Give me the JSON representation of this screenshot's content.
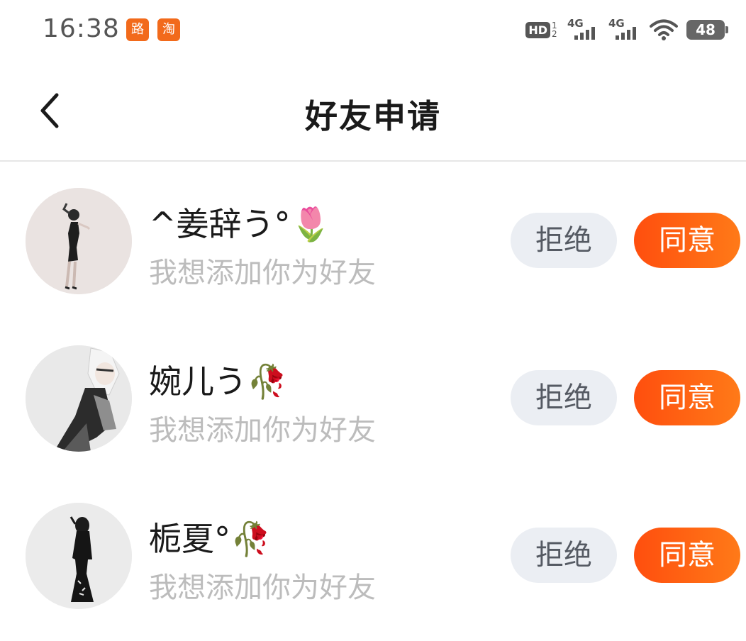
{
  "status_bar": {
    "time": "16:38",
    "app_badges": [
      "路",
      "淘"
    ],
    "hd_label": "HD",
    "hd_sub": "1 2",
    "signals": [
      "4G",
      "4G"
    ],
    "battery": "48"
  },
  "header": {
    "title": "好友申请",
    "back_icon": "chevron-left-icon"
  },
  "requests": [
    {
      "name": "^姜辞う°🌷",
      "message": "我想添加你为好友",
      "reject_label": "拒绝",
      "accept_label": "同意"
    },
    {
      "name": "婉儿う🥀",
      "message": "我想添加你为好友",
      "reject_label": "拒绝",
      "accept_label": "同意"
    },
    {
      "name": "栀夏°🥀",
      "message": "我想添加你为好友",
      "reject_label": "拒绝",
      "accept_label": "同意"
    }
  ],
  "colors": {
    "accent": "#ff5a10",
    "reject_bg": "#ebeef3",
    "secondary_text": "#bcbcbc"
  }
}
